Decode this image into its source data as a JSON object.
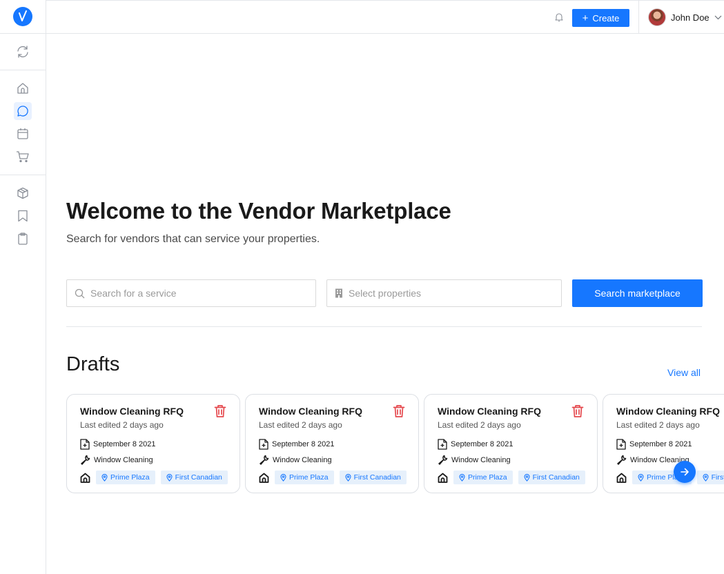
{
  "colors": {
    "accent": "#1677ff",
    "danger": "#e5484d",
    "tag_bg": "#e6f0fb"
  },
  "sidebar": {
    "logo_icon": "check-logo-icon",
    "items": [
      {
        "icon": "refresh-icon",
        "group": 1
      },
      {
        "icon": "home-icon",
        "group": 2
      },
      {
        "icon": "chat-bubble-icon",
        "group": 2,
        "active": true
      },
      {
        "icon": "calendar-icon",
        "group": 2
      },
      {
        "icon": "cart-icon",
        "group": 2
      },
      {
        "icon": "package-icon",
        "group": 3
      },
      {
        "icon": "bookmark-icon",
        "group": 3
      },
      {
        "icon": "clipboard-icon",
        "group": 3
      }
    ]
  },
  "header": {
    "bell_icon": "bell-icon",
    "create_label": "Create",
    "user_name": "John Doe"
  },
  "hero": {
    "title": "Welcome to the Vendor Marketplace",
    "subtitle": "Search for vendors that can service your properties."
  },
  "search": {
    "service_placeholder": "Search for a service",
    "properties_placeholder": "Select properties",
    "button_label": "Search marketplace"
  },
  "drafts": {
    "title": "Drafts",
    "view_all": "View all",
    "cards": [
      {
        "title": "Window Cleaning RFQ",
        "edited": "Last edited 2 days ago",
        "date": "September 8 2021",
        "service": "Window Cleaning",
        "tags": [
          "Prime Plaza",
          "First Canadian"
        ]
      },
      {
        "title": "Window Cleaning RFQ",
        "edited": "Last edited 2 days ago",
        "date": "September 8 2021",
        "service": "Window Cleaning",
        "tags": [
          "Prime Plaza",
          "First Canadian"
        ]
      },
      {
        "title": "Window Cleaning RFQ",
        "edited": "Last edited 2 days ago",
        "date": "September 8 2021",
        "service": "Window Cleaning",
        "tags": [
          "Prime Plaza",
          "First Canadian"
        ]
      },
      {
        "title": "Window Cleaning RFQ",
        "edited": "Last edited 2 days ago",
        "date": "September 8 2021",
        "service": "Window Cleaning",
        "tags": [
          "Prime Plaza",
          "First Canadian"
        ]
      }
    ]
  }
}
